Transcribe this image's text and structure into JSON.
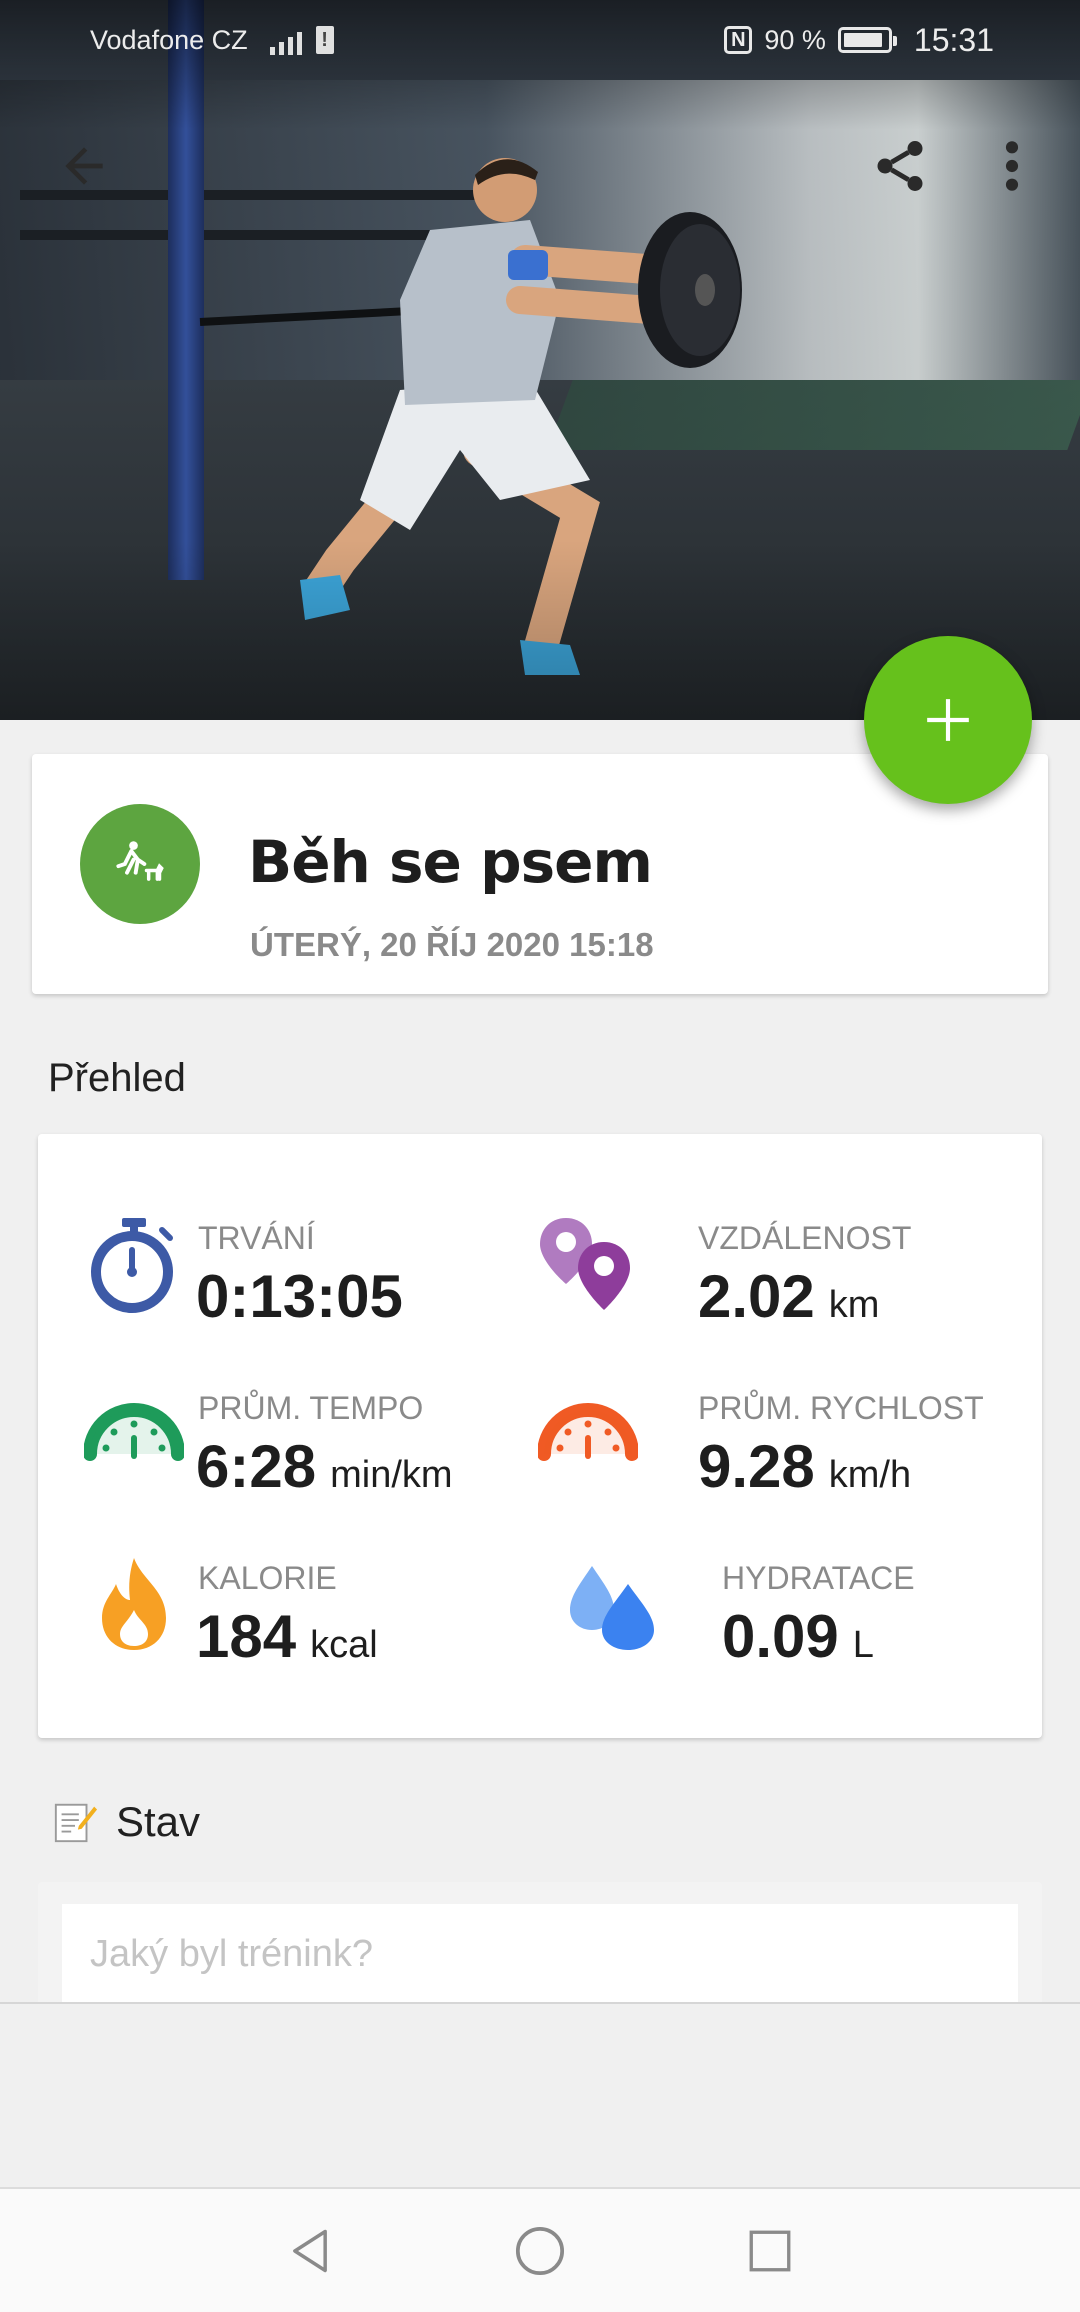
{
  "status_bar": {
    "carrier": "Vodafone CZ",
    "battery_text": "90 %",
    "battery_level": 0.9,
    "time": "15:31",
    "nfc_label": "N"
  },
  "toolbar": {
    "back_icon": "arrow-back-icon",
    "share_icon": "share-icon",
    "menu_icon": "more-vert-icon"
  },
  "fab": {
    "icon": "plus-icon",
    "color": "#66c11c"
  },
  "workout": {
    "title": "Běh se psem",
    "date": "ÚTERÝ, 20 ŘÍJ 2020 15:18",
    "icon": "dog-walk-icon",
    "icon_color": "#5da540"
  },
  "overview": {
    "title": "Přehled",
    "stats": [
      {
        "label": "TRVÁNÍ",
        "value": "0:13:05",
        "unit": "",
        "icon": "stopwatch-icon",
        "color": "#3d5aa6"
      },
      {
        "label": "VZDÁLENOST",
        "value": "2.02",
        "unit": "km",
        "icon": "location-pins-icon",
        "color": "#8e3d9b"
      },
      {
        "label": "PRŮM. TEMPO",
        "value": "6:28",
        "unit": "min/km",
        "icon": "speedometer-icon",
        "color": "#1e9b5a"
      },
      {
        "label": "PRŮM. RYCHLOST",
        "value": "9.28",
        "unit": "km/h",
        "icon": "speedometer-icon",
        "color": "#f05a24"
      },
      {
        "label": "KALORIE",
        "value": "184",
        "unit": "kcal",
        "icon": "flame-icon",
        "color": "#f7a024"
      },
      {
        "label": "HYDRATACE",
        "value": "0.09",
        "unit": "L",
        "icon": "water-drops-icon",
        "color": "#3b82f0"
      }
    ]
  },
  "status_section": {
    "label": "Stav",
    "icon": "note-pencil-icon",
    "placeholder": "Jaký byl trénink?"
  },
  "nav": {
    "back_icon": "nav-back-icon",
    "home_icon": "nav-home-icon",
    "recents_icon": "nav-recents-icon"
  }
}
